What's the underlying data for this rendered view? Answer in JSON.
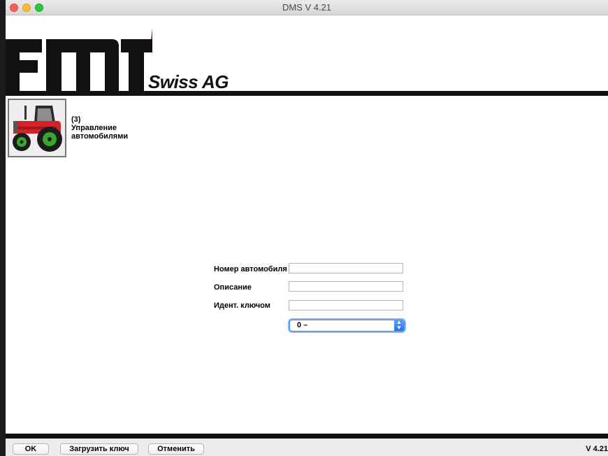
{
  "window": {
    "title": "DMS V 4.21"
  },
  "header": {
    "logo_text": "FMT",
    "logo_subtitle": "Swiss AG"
  },
  "module_tile": {
    "icon": "tractor-icon",
    "count": "(3)",
    "caption_line1": "Управление",
    "caption_line2": "автомобилями"
  },
  "form": {
    "vehicle_number_label": "Номер автомобиля",
    "vehicle_number_value": "",
    "description_label": "Описание",
    "description_value": "",
    "key_id_label": "Идент. ключом",
    "key_id_value": "",
    "select_value": "0 –"
  },
  "footer": {
    "ok_label": "OK",
    "load_key_label": "Загрузить ключ",
    "cancel_label": "Отменить",
    "version": "V 4.21"
  },
  "colors": {
    "logo_accent": "#9b1c1f",
    "header_rule": "#111111",
    "select_focus": "#3b8be8"
  }
}
